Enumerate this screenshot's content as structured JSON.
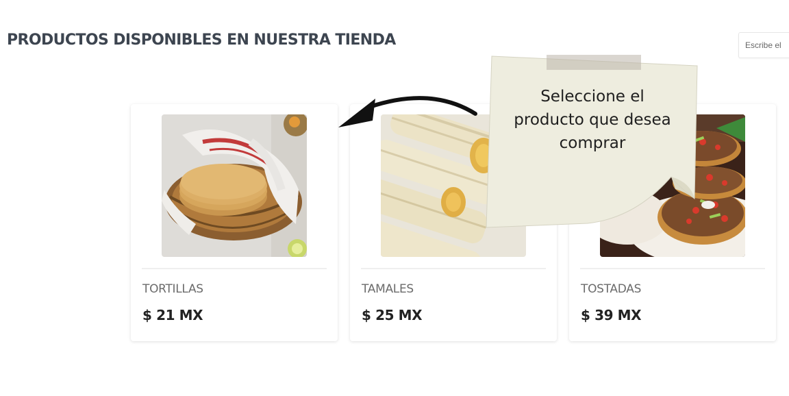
{
  "header": {
    "title": "PRODUCTOS DISPONIBLES EN NUESTRA TIENDA",
    "search_placeholder": "Escribe el"
  },
  "products": [
    {
      "name": "TORTILLAS",
      "price": "$ 21 MX",
      "image": "tortillas-photo"
    },
    {
      "name": "TAMALES",
      "price": "$ 25 MX",
      "image": "tamales-photo"
    },
    {
      "name": "TOSTADAS",
      "price": "$ 39 MX",
      "image": "tostadas-photo"
    }
  ],
  "annotation": {
    "lines": [
      "Seleccione el",
      "producto que desea",
      "comprar"
    ],
    "arrow_icon": "curved-arrow-left-icon"
  }
}
